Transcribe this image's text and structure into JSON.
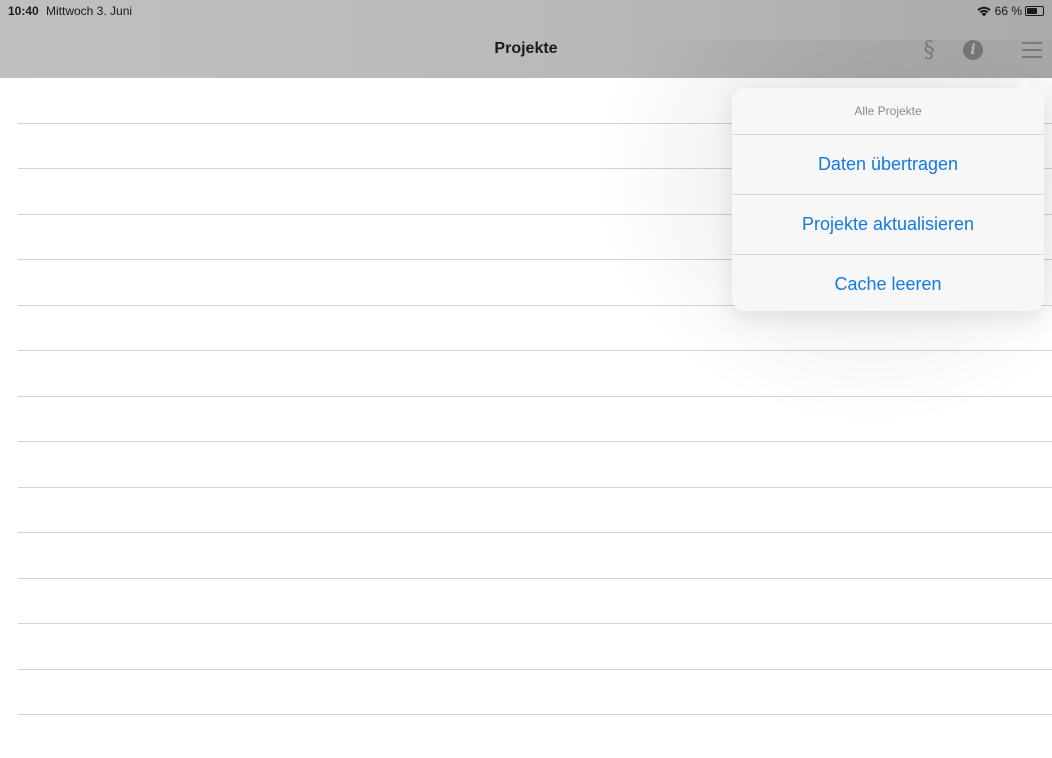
{
  "status_bar": {
    "time": "10:40",
    "date": "Mittwoch 3. Juni",
    "battery_percent": "66 %",
    "battery_level": 0.66,
    "wifi_icon": "wifi-icon",
    "battery_icon": "battery-icon"
  },
  "nav_bar": {
    "title": "Projekte",
    "paragraph_symbol": "§",
    "info_symbol": "i",
    "icons": [
      "paragraph-icon",
      "info-icon",
      "menu-icon"
    ]
  },
  "popover": {
    "header": "Alle Projekte",
    "items": [
      {
        "label": "Daten übertragen"
      },
      {
        "label": "Projekte aktualisieren"
      },
      {
        "label": "Cache leeren"
      }
    ]
  },
  "colors": {
    "accent": "#1479e6",
    "nav_background": "#b9b9b9"
  }
}
